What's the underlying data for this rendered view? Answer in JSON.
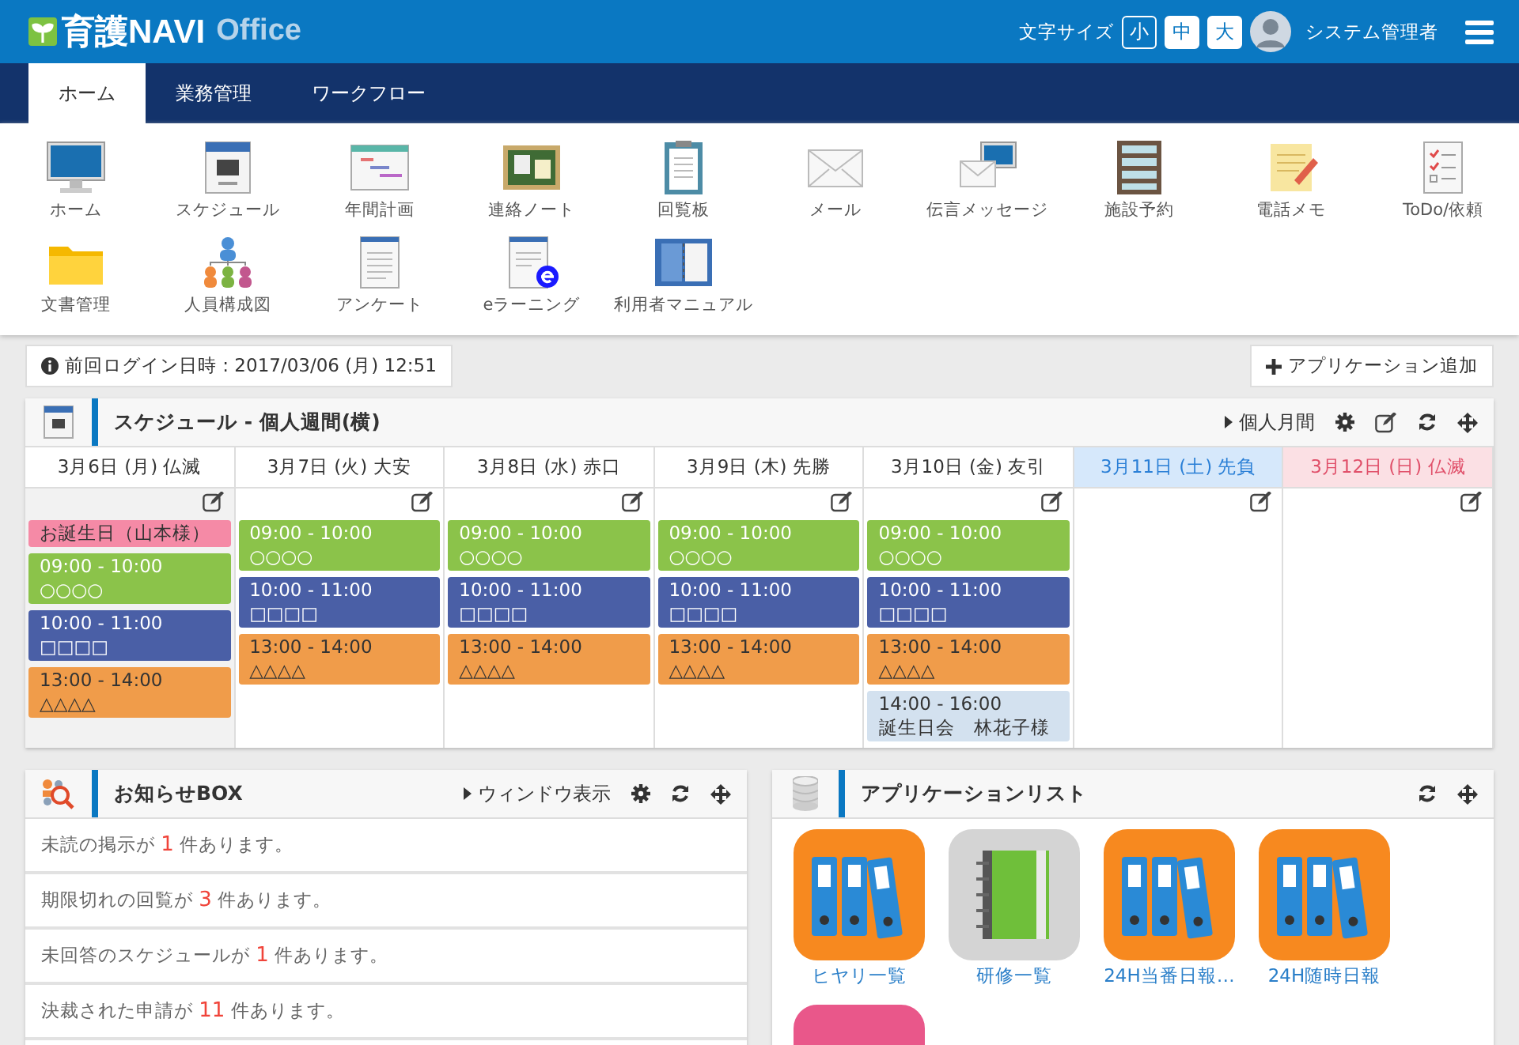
{
  "header": {
    "logo": "育護NAVI",
    "logo_suffix": "Office",
    "font_size_label": "文字サイズ",
    "font_sizes": [
      {
        "label": "小",
        "selected": true
      },
      {
        "label": "中",
        "selected": false
      },
      {
        "label": "大",
        "selected": false
      }
    ],
    "user": "システム管理者"
  },
  "tabs": [
    {
      "label": "ホーム",
      "selected": true
    },
    {
      "label": "業務管理",
      "selected": false
    },
    {
      "label": "ワークフロー",
      "selected": false
    }
  ],
  "launcher": [
    {
      "label": "ホーム",
      "kind": "monitor"
    },
    {
      "label": "スケジュール",
      "kind": "calendar"
    },
    {
      "label": "年間計画",
      "kind": "gantt"
    },
    {
      "label": "連絡ノート",
      "kind": "board"
    },
    {
      "label": "回覧板",
      "kind": "clipboard"
    },
    {
      "label": "メール",
      "kind": "mail"
    },
    {
      "label": "伝言メッセージ",
      "kind": "message"
    },
    {
      "label": "施設予約",
      "kind": "shelf"
    },
    {
      "label": "電話メモ",
      "kind": "memo"
    },
    {
      "label": "ToDo/依頼",
      "kind": "todo"
    },
    {
      "label": "文書管理",
      "kind": "folder"
    },
    {
      "label": "人員構成図",
      "kind": "org"
    },
    {
      "label": "アンケート",
      "kind": "doc"
    },
    {
      "label": "eラーニング",
      "kind": "elearn"
    },
    {
      "label": "利用者マニュアル",
      "kind": "manual"
    }
  ],
  "login_info": "前回ログイン日時 : 2017/03/06 (月) 12:51",
  "add_app_button": "アプリケーション追加",
  "schedule": {
    "title": "スケジュール - 個人週間(横)",
    "month_link": "個人月間",
    "days": [
      {
        "label": "3月6日 (月) 仏滅",
        "kind": "weekday",
        "today": true,
        "events": [
          {
            "title": "お誕生日（山本様）",
            "color": "#f58aa6"
          },
          {
            "time": "09:00 - 10:00",
            "title": "○○○○",
            "color": "#8bc34a"
          },
          {
            "time": "10:00 - 11:00",
            "title": "□□□□",
            "color": "#4a5fa6"
          },
          {
            "time": "13:00 - 14:00",
            "title": "△△△△",
            "color": "#f09c4a"
          }
        ]
      },
      {
        "label": "3月7日 (火) 大安",
        "kind": "weekday",
        "today": false,
        "events": [
          {
            "time": "09:00 - 10:00",
            "title": "○○○○",
            "color": "#8bc34a"
          },
          {
            "time": "10:00 - 11:00",
            "title": "□□□□",
            "color": "#4a5fa6"
          },
          {
            "time": "13:00 - 14:00",
            "title": "△△△△",
            "color": "#f09c4a"
          }
        ]
      },
      {
        "label": "3月8日 (水) 赤口",
        "kind": "weekday",
        "today": false,
        "events": [
          {
            "time": "09:00 - 10:00",
            "title": "○○○○",
            "color": "#8bc34a"
          },
          {
            "time": "10:00 - 11:00",
            "title": "□□□□",
            "color": "#4a5fa6"
          },
          {
            "time": "13:00 - 14:00",
            "title": "△△△△",
            "color": "#f09c4a"
          }
        ]
      },
      {
        "label": "3月9日 (木) 先勝",
        "kind": "weekday",
        "today": false,
        "events": [
          {
            "time": "09:00 - 10:00",
            "title": "○○○○",
            "color": "#8bc34a"
          },
          {
            "time": "10:00 - 11:00",
            "title": "□□□□",
            "color": "#4a5fa6"
          },
          {
            "time": "13:00 - 14:00",
            "title": "△△△△",
            "color": "#f09c4a"
          }
        ]
      },
      {
        "label": "3月10日 (金) 友引",
        "kind": "weekday",
        "today": false,
        "events": [
          {
            "time": "09:00 - 10:00",
            "title": "○○○○",
            "color": "#8bc34a"
          },
          {
            "time": "10:00 - 11:00",
            "title": "□□□□",
            "color": "#4a5fa6"
          },
          {
            "time": "13:00 - 14:00",
            "title": "△△△△",
            "color": "#f09c4a"
          },
          {
            "time": "14:00 - 16:00",
            "title": "誕生日会　林花子様",
            "color": "#d3e1ef"
          }
        ]
      },
      {
        "label": "3月11日 (土) 先負",
        "kind": "saturday",
        "today": false
      },
      {
        "label": "3月12日 (日) 仏滅",
        "kind": "sunday",
        "today": false
      }
    ]
  },
  "notices": {
    "title": "お知らせBOX",
    "window_link": "ウィンドウ表示",
    "items": [
      {
        "before": "未読の掲示が",
        "count": "1",
        "after": "件あります。"
      },
      {
        "before": "期限切れの回覧が",
        "count": "3",
        "after": "件あります。"
      },
      {
        "before": "未回答のスケジュールが",
        "count": "1",
        "after": "件あります。"
      },
      {
        "before": "決裁された申請が",
        "count": "11",
        "after": "件あります。"
      }
    ]
  },
  "apps": {
    "title": "アプリケーションリスト",
    "items": [
      {
        "label": "ヒヤリ一覧",
        "kind": "binders",
        "color": "#f7891f"
      },
      {
        "label": "研修一覧",
        "kind": "notebook",
        "color": "#d4d4d4"
      },
      {
        "label": "24H当番日報…",
        "kind": "binders",
        "color": "#f7891f"
      },
      {
        "label": "24H随時日報",
        "kind": "binders",
        "color": "#f7891f"
      },
      {
        "kind": "blank",
        "color": "#e9578a"
      }
    ]
  }
}
